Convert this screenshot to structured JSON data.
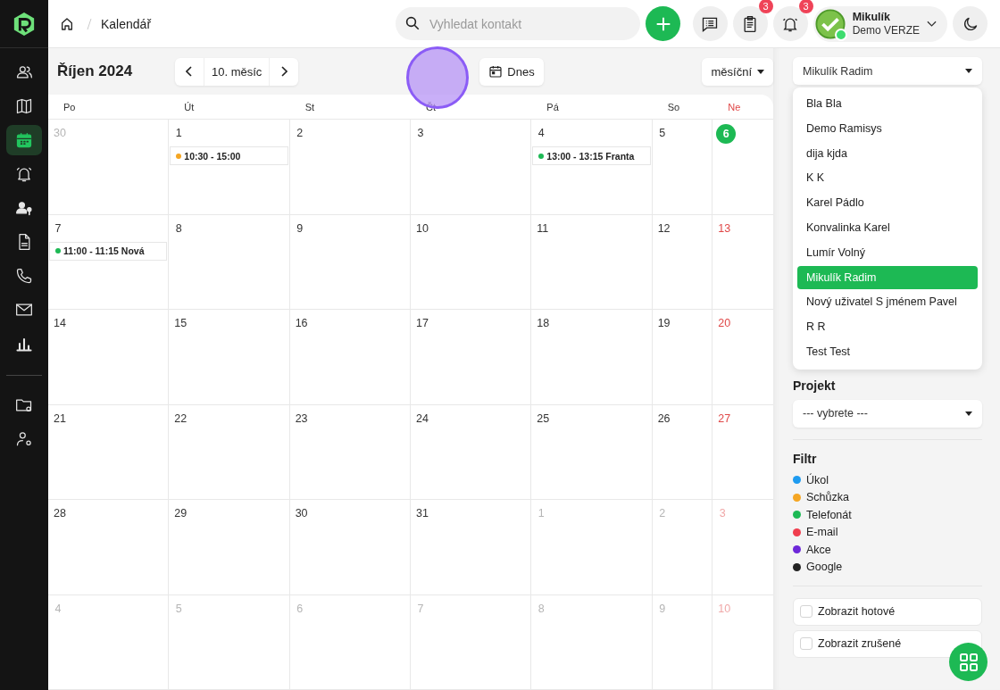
{
  "sidebar": {
    "items": [
      {
        "selected": false
      },
      {
        "selected": false
      },
      {
        "selected": true
      },
      {
        "selected": false
      },
      {
        "selected": false
      },
      {
        "selected": false
      },
      {
        "selected": false
      },
      {
        "selected": false
      },
      {
        "selected": false
      }
    ],
    "bottom_items": [
      {
        "selected": false
      },
      {
        "selected": false
      }
    ]
  },
  "breadcrumb": [
    "Kalendář"
  ],
  "search": {
    "placeholder": "Vyhledat kontakt"
  },
  "notifications": {
    "tasks_badge": "3",
    "alerts_badge": "3"
  },
  "user": {
    "name": "Mikulík",
    "subtitle": "Demo VERZE",
    "online": true
  },
  "toolbar": {
    "title": "Říjen 2024",
    "period": "10. měsíc",
    "today_button": "Dnes",
    "view": "měsíční"
  },
  "calendar": {
    "weekdays": [
      "Po",
      "Út",
      "St",
      "Čt",
      "Pá",
      "So",
      "Ne"
    ],
    "weeks": [
      [
        {
          "day": "30",
          "other_month": true,
          "today": false
        },
        {
          "day": "1",
          "other_month": false,
          "today": false,
          "events": [
            {
              "text": "10:30 - 15:00",
              "color": "#f5a623"
            }
          ]
        },
        {
          "day": "2",
          "other_month": false,
          "today": false
        },
        {
          "day": "3",
          "other_month": false,
          "today": false
        },
        {
          "day": "4",
          "other_month": false,
          "today": false,
          "events": [
            {
              "text": "13:00 - 13:15 Franta",
              "color": "#1db954"
            }
          ]
        },
        {
          "day": "5",
          "other_month": false,
          "today": false
        },
        {
          "day": "6",
          "other_month": false,
          "today": true
        }
      ],
      [
        {
          "day": "7",
          "other_month": false,
          "today": false,
          "events": [
            {
              "text": "11:00 - 11:15 Nová",
              "color": "#1db954"
            }
          ]
        },
        {
          "day": "8",
          "other_month": false,
          "today": false
        },
        {
          "day": "9",
          "other_month": false,
          "today": false
        },
        {
          "day": "10",
          "other_month": false,
          "today": false
        },
        {
          "day": "11",
          "other_month": false,
          "today": false
        },
        {
          "day": "12",
          "other_month": false,
          "today": false
        },
        {
          "day": "13",
          "other_month": false,
          "today": false
        }
      ],
      [
        {
          "day": "14",
          "other_month": false,
          "today": false
        },
        {
          "day": "15",
          "other_month": false,
          "today": false
        },
        {
          "day": "16",
          "other_month": false,
          "today": false
        },
        {
          "day": "17",
          "other_month": false,
          "today": false
        },
        {
          "day": "18",
          "other_month": false,
          "today": false
        },
        {
          "day": "19",
          "other_month": false,
          "today": false
        },
        {
          "day": "20",
          "other_month": false,
          "today": false
        }
      ],
      [
        {
          "day": "21",
          "other_month": false,
          "today": false
        },
        {
          "day": "22",
          "other_month": false,
          "today": false
        },
        {
          "day": "23",
          "other_month": false,
          "today": false
        },
        {
          "day": "24",
          "other_month": false,
          "today": false
        },
        {
          "day": "25",
          "other_month": false,
          "today": false
        },
        {
          "day": "26",
          "other_month": false,
          "today": false
        },
        {
          "day": "27",
          "other_month": false,
          "today": false
        }
      ],
      [
        {
          "day": "28",
          "other_month": false,
          "today": false
        },
        {
          "day": "29",
          "other_month": false,
          "today": false
        },
        {
          "day": "30",
          "other_month": false,
          "today": false
        },
        {
          "day": "31",
          "other_month": false,
          "today": false
        },
        {
          "day": "1",
          "other_month": true,
          "today": false
        },
        {
          "day": "2",
          "other_month": true,
          "today": false
        },
        {
          "day": "3",
          "other_month": true,
          "today": false
        }
      ],
      [
        {
          "day": "4",
          "other_month": true,
          "today": false
        },
        {
          "day": "5",
          "other_month": true,
          "today": false
        },
        {
          "day": "6",
          "other_month": true,
          "today": false
        },
        {
          "day": "7",
          "other_month": true,
          "today": false
        },
        {
          "day": "8",
          "other_month": true,
          "today": false
        },
        {
          "day": "9",
          "other_month": true,
          "today": false
        },
        {
          "day": "10",
          "other_month": true,
          "today": false
        }
      ]
    ]
  },
  "user_select": {
    "value": "Mikulík Radim",
    "options": [
      {
        "label": "Bla Bla",
        "selected": false
      },
      {
        "label": "Demo Ramisys",
        "selected": false
      },
      {
        "label": "dija kjda",
        "selected": false
      },
      {
        "label": "K K",
        "selected": false
      },
      {
        "label": "Karel Pádlo",
        "selected": false
      },
      {
        "label": "Konvalinka Karel",
        "selected": false
      },
      {
        "label": "Lumír Volný",
        "selected": false
      },
      {
        "label": "Mikulík Radim",
        "selected": true
      },
      {
        "label": "Nový uživatel S jménem Pavel",
        "selected": false
      },
      {
        "label": "R R",
        "selected": false
      },
      {
        "label": "Test Test",
        "selected": false
      }
    ]
  },
  "project": {
    "label": "Projekt",
    "value": "--- vybrete ---"
  },
  "filter": {
    "title": "Filtr",
    "items": [
      {
        "label": "Úkol",
        "color": "#1e9bf0"
      },
      {
        "label": "Schůzka",
        "color": "#f5a623"
      },
      {
        "label": "Telefonát",
        "color": "#1db954"
      },
      {
        "label": "E-mail",
        "color": "#f03e4e"
      },
      {
        "label": "Akce",
        "color": "#6d28d9"
      },
      {
        "label": "Google",
        "color": "#222222"
      }
    ]
  },
  "checkboxes": [
    {
      "label": "Zobrazit hotové",
      "checked": false
    },
    {
      "label": "Zobrazit zrušené",
      "checked": false
    }
  ]
}
